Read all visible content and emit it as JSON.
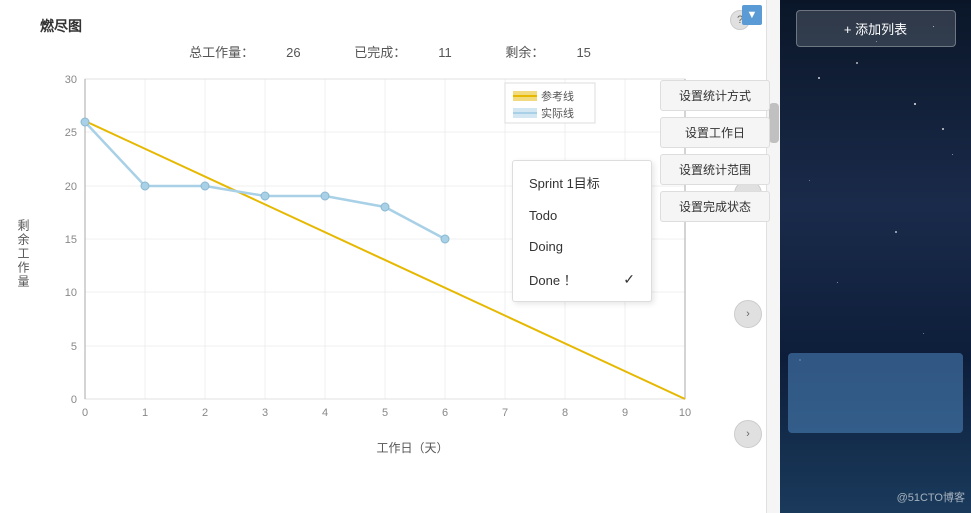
{
  "chart": {
    "title": "燃尽图",
    "stats": {
      "total_label": "总工作量：",
      "total_value": "26",
      "done_label": "已完成：",
      "done_value": "11",
      "remaining_label": "剩余：",
      "remaining_value": "15"
    },
    "legend": {
      "ref_label": "参考线",
      "actual_label": "实际线"
    },
    "y_axis_label": "剩\n余\n工\n作\n量",
    "x_axis_label": "工作日（天）",
    "y_ticks": [
      "0",
      "5",
      "10",
      "15",
      "20",
      "25",
      "30"
    ],
    "x_ticks": [
      "0",
      "1",
      "2",
      "3",
      "4",
      "5",
      "6",
      "7",
      "8",
      "9",
      "10"
    ],
    "ref_line": {
      "points": [
        [
          0,
          26
        ],
        [
          10,
          0
        ]
      ],
      "color": "#e6b800"
    },
    "actual_line": {
      "points": [
        [
          0,
          26
        ],
        [
          1,
          20
        ],
        [
          2,
          20
        ],
        [
          3,
          19
        ],
        [
          4,
          19
        ],
        [
          5,
          18
        ],
        [
          6,
          15
        ]
      ],
      "color": "#a8d0e6"
    }
  },
  "buttons": {
    "set_stat_method": "设置统计方式",
    "set_workday": "设置工作日",
    "set_stat_range": "设置统计范围",
    "set_done_status": "设置完成状态"
  },
  "status_menu": {
    "items": [
      {
        "label": "Sprint 1目标",
        "checked": false
      },
      {
        "label": "Todo",
        "checked": false
      },
      {
        "label": "Doing",
        "checked": false
      },
      {
        "label": "Done ！",
        "checked": true
      }
    ]
  },
  "right_panel": {
    "add_list_btn": "+ 添加列表",
    "watermark": "@51CTO博客"
  },
  "help_icon": "?",
  "collapse_icon": "▼"
}
